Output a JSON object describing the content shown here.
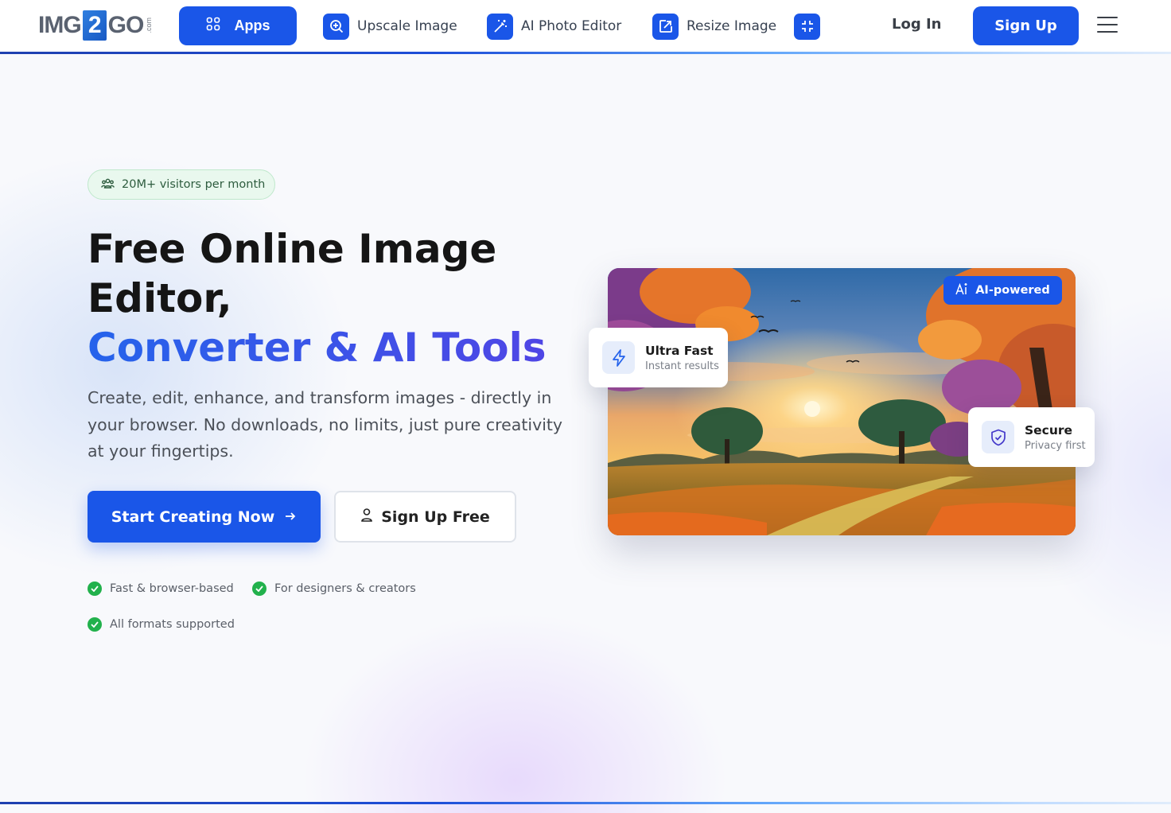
{
  "header": {
    "logo": {
      "left": "IMG",
      "middle": "2",
      "right": "GO",
      "suffix": ".com"
    },
    "apps_label": "Apps",
    "nav": [
      {
        "label": "Upscale Image",
        "icon": "search-plus-icon"
      },
      {
        "label": "AI Photo Editor",
        "icon": "magic-wand-icon"
      },
      {
        "label": "Resize Image",
        "icon": "resize-icon"
      },
      {
        "label": "",
        "icon": "compress-icon"
      }
    ],
    "login_label": "Log In",
    "signup_label": "Sign Up"
  },
  "hero": {
    "badge": "20M+ visitors per month",
    "title_line1": "Free Online Image",
    "title_line2": "Editor,",
    "title_accent": "Converter & AI Tools",
    "description": "Create, edit, enhance, and transform images - directly in your browser. No downloads, no limits, just pure creativity at your fingertips.",
    "cta_primary": "Start Creating Now",
    "cta_secondary": "Sign Up Free",
    "features": [
      "Fast & browser-based",
      "For designers & creators",
      "All formats supported"
    ]
  },
  "preview": {
    "ai_badge": "AI-powered",
    "cards": [
      {
        "title": "Ultra Fast",
        "subtitle": "Instant results"
      },
      {
        "title": "Secure",
        "subtitle": "Privacy first"
      }
    ]
  },
  "colors": {
    "primary": "#1a56e8",
    "success": "#22b14c",
    "badge_bg": "#e9f8ee"
  }
}
